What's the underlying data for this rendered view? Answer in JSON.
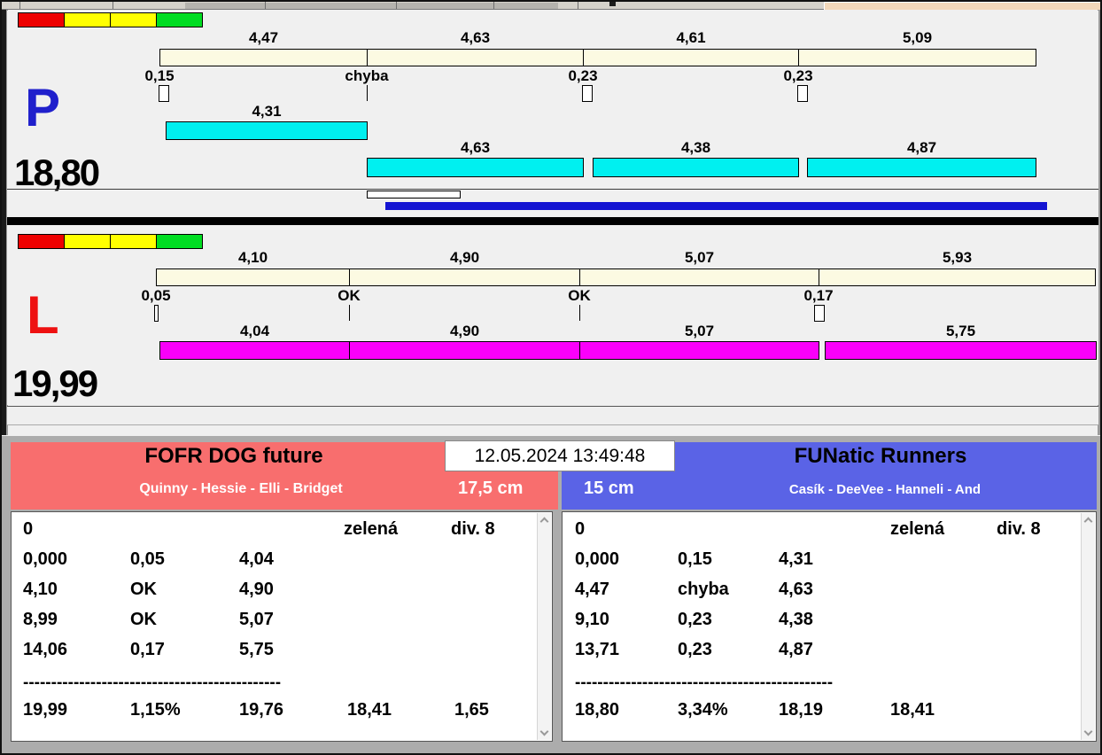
{
  "datetime": "12.05.2024 13:49:48",
  "icons": {
    "scrollbar_up": "chevron-up",
    "scrollbar_down": "chevron-down"
  },
  "colors": {
    "panel_background": "#f0f0f0",
    "lane_p_letter": "#2020cc",
    "lane_l_letter": "#ee1111",
    "split_bar": "#fcfae2",
    "run_bar_p": "#00f0f0",
    "run_bar_l": "#fa00fa",
    "progress_bar": "#1414d2",
    "team_left_header": "#f86e6e",
    "team_right_header": "#5a63e6",
    "traffic_lights": [
      "#ee0000",
      "#ffff00",
      "#ffff00",
      "#00dd22"
    ]
  },
  "lanes": [
    {
      "letter": "P",
      "total_time": "18,80",
      "split_times": [
        "4,47",
        "4,63",
        "4,61",
        "5,09"
      ],
      "exchange_results": [
        "0,15",
        "chyba",
        "0,23",
        "0,23"
      ],
      "run_times": [
        "4,31",
        "4,63",
        "4,38",
        "4,87"
      ]
    },
    {
      "letter": "L",
      "total_time": "19,99",
      "split_times": [
        "4,10",
        "4,90",
        "5,07",
        "5,93"
      ],
      "exchange_results": [
        "0,05",
        "OK",
        "OK",
        "0,17"
      ],
      "run_times": [
        "4,04",
        "4,90",
        "5,07",
        "5,75"
      ]
    }
  ],
  "teams": [
    {
      "name": "FOFR DOG future",
      "members": "Quinny - Hessie - Elli - Bridget",
      "jump_height": "17,5 cm",
      "result_panel": {
        "start_value": "0",
        "category": "zelená",
        "division": "div. 8",
        "rows": [
          [
            "0,000",
            "0,05",
            "4,04"
          ],
          [
            "4,10",
            "OK",
            "4,90"
          ],
          [
            "8,99",
            "OK",
            "5,07"
          ],
          [
            "14,06",
            "0,17",
            "5,75"
          ]
        ],
        "separator": "----------------------------------------------",
        "totals": [
          "19,99",
          "1,15%",
          "19,76",
          "18,41",
          "1,65"
        ]
      }
    },
    {
      "name": "FUNatic Runners",
      "members": "Casík - DeeVee - Hanneli - And",
      "jump_height": "15 cm",
      "result_panel": {
        "start_value": "0",
        "category": "zelená",
        "division": "div. 8",
        "rows": [
          [
            "0,000",
            "0,15",
            "4,31"
          ],
          [
            "4,47",
            "chyba",
            "4,63"
          ],
          [
            "9,10",
            "0,23",
            "4,38"
          ],
          [
            "13,71",
            "0,23",
            "4,87"
          ]
        ],
        "separator": "----------------------------------------------",
        "totals": [
          "18,80",
          "3,34%",
          "18,19",
          "18,41"
        ]
      }
    }
  ]
}
